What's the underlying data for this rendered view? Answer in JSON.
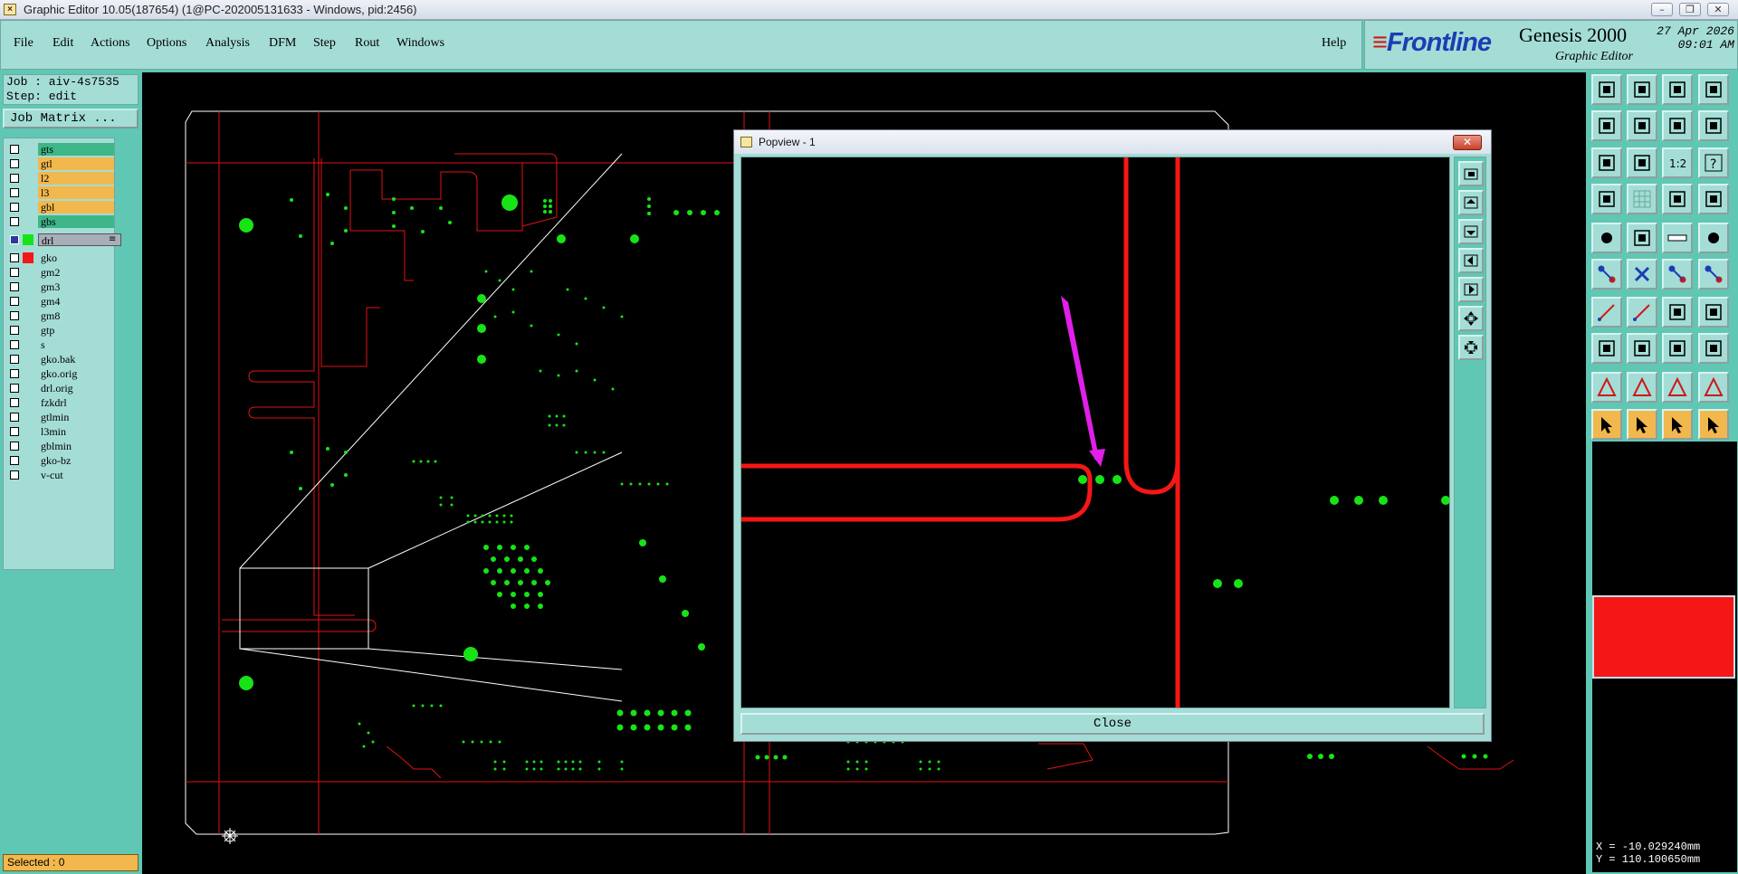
{
  "window": {
    "title": "Graphic Editor 10.05(187654) (1@PC-202005131633 - Windows, pid:2456)"
  },
  "menu": {
    "items": [
      "File",
      "Edit",
      "Actions",
      "Options",
      "Analysis",
      "DFM",
      "Step",
      "Rout",
      "Windows"
    ],
    "help": "Help"
  },
  "brand": {
    "logo": "Frontline",
    "product": "Genesis 2000",
    "subtitle": "Graphic Editor",
    "date": "27 Apr 2026",
    "time": "09:01 AM"
  },
  "job": {
    "job_line": "Job : aiv-4s7535",
    "step_line": "Step: edit",
    "matrix_button": "Job Matrix ..."
  },
  "layers": [
    {
      "name": "gts",
      "color": "#3fb68a",
      "swatch": ""
    },
    {
      "name": "gtl",
      "color": "#f3b84d",
      "swatch": ""
    },
    {
      "name": "l2",
      "color": "#f3b84d",
      "swatch": ""
    },
    {
      "name": "l3",
      "color": "#f3b84d",
      "swatch": ""
    },
    {
      "name": "gbl",
      "color": "#f3b84d",
      "swatch": ""
    },
    {
      "name": "gbs",
      "color": "#3fb68a",
      "swatch": ""
    },
    {
      "name": "drl",
      "color": "#a8aeb8",
      "swatch": "#17e317",
      "active": true
    },
    {
      "name": "gko",
      "color": "#a4dcd6",
      "swatch": "#f51616"
    },
    {
      "name": "gm2",
      "color": "#a4dcd6",
      "swatch": ""
    },
    {
      "name": "gm3",
      "color": "#a4dcd6",
      "swatch": ""
    },
    {
      "name": "gm4",
      "color": "#a4dcd6",
      "swatch": ""
    },
    {
      "name": "gm8",
      "color": "#a4dcd6",
      "swatch": ""
    },
    {
      "name": "gtp",
      "color": "#a4dcd6",
      "swatch": ""
    },
    {
      "name": "s",
      "color": "#a4dcd6",
      "swatch": ""
    },
    {
      "name": "gko.bak",
      "color": "#a4dcd6",
      "swatch": ""
    },
    {
      "name": "gko.orig",
      "color": "#a4dcd6",
      "swatch": ""
    },
    {
      "name": "drl.orig",
      "color": "#a4dcd6",
      "swatch": ""
    },
    {
      "name": "fzkdrl",
      "color": "#a4dcd6",
      "swatch": ""
    },
    {
      "name": "gtlmin",
      "color": "#a4dcd6",
      "swatch": ""
    },
    {
      "name": "l3min",
      "color": "#a4dcd6",
      "swatch": ""
    },
    {
      "name": "gblmin",
      "color": "#a4dcd6",
      "swatch": ""
    },
    {
      "name": "gko-bz",
      "color": "#a4dcd6",
      "swatch": ""
    },
    {
      "name": "v-cut",
      "color": "#a4dcd6",
      "swatch": ""
    }
  ],
  "status": {
    "selected": "Selected : 0"
  },
  "coords": {
    "x": "X = -10.029240mm",
    "y": "Y = 110.100650mm"
  },
  "popview": {
    "title": "Popview - 1",
    "close_label": "Close"
  },
  "colors": {
    "panel": "#a4dcd6",
    "bg": "#5fc7b4",
    "trace": "#f51616",
    "drill": "#17e317",
    "yellow": "#f3b84d",
    "arrow": "#e020e8"
  }
}
